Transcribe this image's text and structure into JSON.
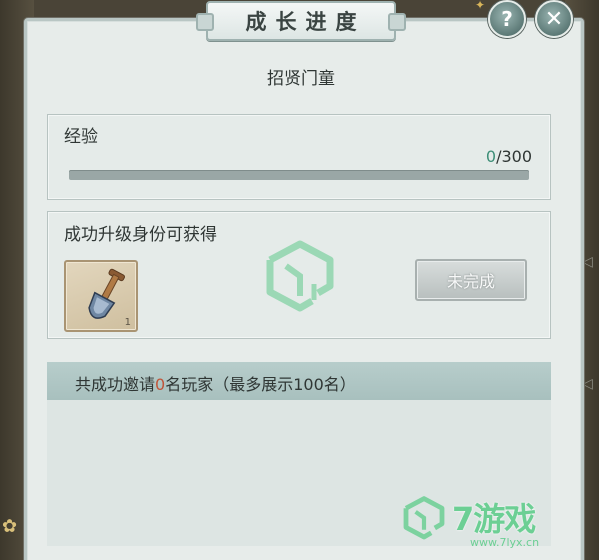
{
  "window": {
    "title": "成长进度",
    "help_symbol": "?",
    "close_symbol": "✕"
  },
  "rank_name": "招贤门童",
  "experience": {
    "label": "经验",
    "current": "0",
    "separator": "/",
    "max": "300",
    "progress_fraction": 0.0
  },
  "reward": {
    "label": "成功升级身份可获得",
    "item": {
      "icon": "shovel-icon",
      "count": "1"
    },
    "status_label": "未完成"
  },
  "invite": {
    "prefix": "共成功邀请",
    "count": "0",
    "suffix": "名玩家（最多展示100名）"
  },
  "watermark": {
    "site_name": "7游戏",
    "url": "www.7lyx.cn"
  },
  "colors": {
    "accent_green": "#3e8f78",
    "count_red": "#c0553a",
    "panel_bg": "#e7ecea"
  }
}
